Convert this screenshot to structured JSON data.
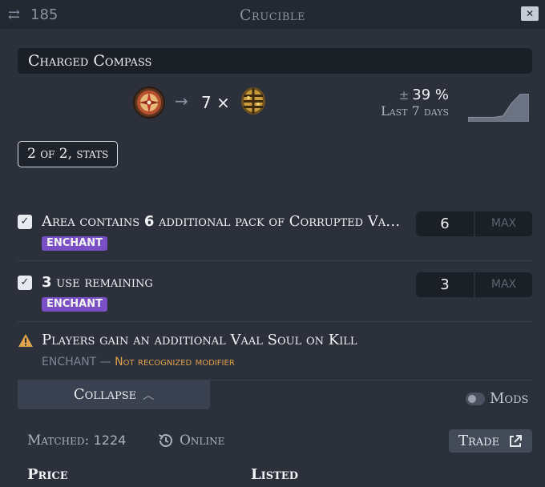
{
  "titlebar": {
    "swap_icon": "swap-arrows-icon",
    "swap_count": "185",
    "title": "Crucible",
    "close_icon": "close-icon"
  },
  "item": {
    "name": "Charged Compass"
  },
  "exchange": {
    "from_icon": "charged-compass-icon",
    "arrow": "→",
    "amount": "7 ×",
    "to_icon": "vaal-orb-icon"
  },
  "price_change": {
    "prefix": "±",
    "value": "39 %",
    "period": "Last 7 days",
    "sparkline": [
      0.05,
      0.05,
      0.05,
      0.05,
      0.1,
      0.6,
      0.95,
      0.95
    ],
    "sparkline_color": "#6b7282"
  },
  "stats_pill": "2 of 2, stats",
  "modifiers": [
    {
      "checked": true,
      "text_before": "Area contains ",
      "number": "6",
      "text_after": " additional pack of Corrupted Vaal Monsters",
      "tag": "ENCHANT",
      "value": "6",
      "max_label": "MAX"
    },
    {
      "checked": true,
      "text_before": "",
      "number": "3",
      "text_after": " use remaining",
      "tag": "ENCHANT",
      "value": "3",
      "max_label": "MAX"
    }
  ],
  "unrecognized": {
    "icon": "warning-icon",
    "text": "Players gain an additional Vaal Soul on Kill",
    "type": "ENCHANT",
    "dash": " — ",
    "note": "Not recognized modifier"
  },
  "controls": {
    "collapse_label": "Collapse",
    "collapse_icon": "chevron-up-icon",
    "mods_label": "Mods",
    "mods_toggle_on": false
  },
  "results": {
    "matched_label": "Matched:",
    "matched_count": "1224",
    "online_icon": "history-icon",
    "online_label": "Online",
    "trade_label": "Trade",
    "trade_icon": "external-link-icon"
  },
  "table": {
    "headers": [
      "Price",
      "Listed"
    ]
  },
  "colors": {
    "background": "#2b303b",
    "enchant_tag": "#7a4ec4",
    "warning": "#e0a24a"
  }
}
